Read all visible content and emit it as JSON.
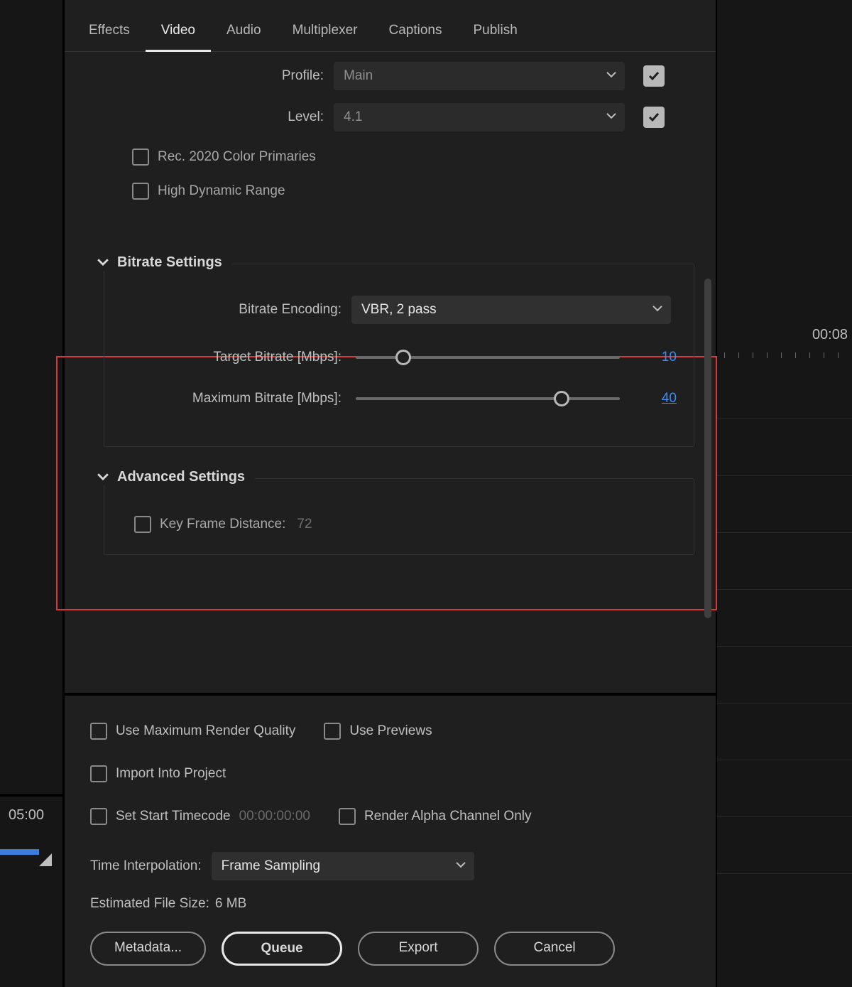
{
  "tabs": {
    "effects": "Effects",
    "video": "Video",
    "audio": "Audio",
    "multiplexer": "Multiplexer",
    "captions": "Captions",
    "publish": "Publish"
  },
  "profile": {
    "label": "Profile:",
    "value": "Main"
  },
  "level": {
    "label": "Level:",
    "value": "4.1"
  },
  "rec2020": "Rec. 2020 Color Primaries",
  "hdr": "High Dynamic Range",
  "bitrate": {
    "title": "Bitrate Settings",
    "encoding_label": "Bitrate Encoding:",
    "encoding_value": "VBR, 2 pass",
    "target_label": "Target Bitrate [Mbps]:",
    "target_value": "10",
    "max_label": "Maximum Bitrate [Mbps]:",
    "max_value": "40"
  },
  "advanced": {
    "title": "Advanced Settings",
    "keyframe_label": "Key Frame Distance:",
    "keyframe_value": "72"
  },
  "bottom": {
    "max_render": "Use Maximum Render Quality",
    "previews": "Use Previews",
    "import": "Import Into Project",
    "start_tc_label": "Set Start Timecode",
    "start_tc_value": "00:00:00:00",
    "alpha": "Render Alpha Channel Only",
    "interp_label": "Time Interpolation:",
    "interp_value": "Frame Sampling",
    "est_label": "Estimated File Size:",
    "est_value": "6 MB",
    "metadata": "Metadata...",
    "queue": "Queue",
    "export": "Export",
    "cancel": "Cancel"
  },
  "timeline": {
    "left_tc": "05:00",
    "right_tc": "00:08"
  }
}
